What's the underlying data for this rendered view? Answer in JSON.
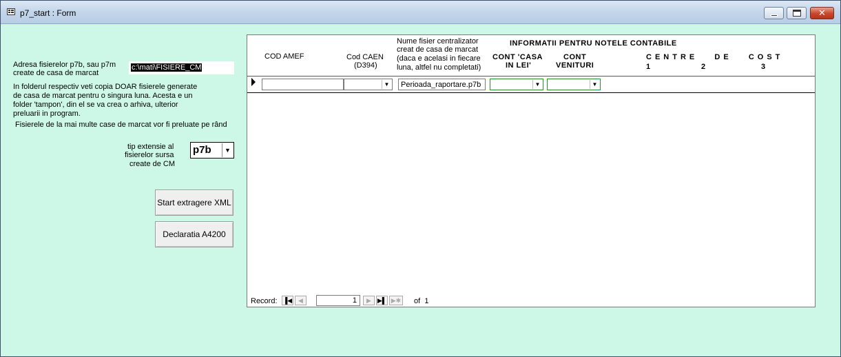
{
  "window": {
    "title": "p7_start : Form"
  },
  "left_panel": {
    "path_label_line1": "Adresa fisierelor p7b, sau p7m",
    "path_label_line2": "create de casa de marcat",
    "path_value": "c:\\mati\\FISIERE_CM",
    "info_lines": [
      "In folderul respectiv veti copia DOAR fisierele generate",
      "de casa de marcat pentru o singura luna. Acesta e un",
      "folder 'tampon', din el se va crea o arhiva, ulterior",
      "preluarii in program.",
      " Fisierele de la mai multe case de marcat vor fi preluate pe rând"
    ],
    "ext_label_lines": [
      "tip extensie al",
      "fisierelor sursa",
      "create de CM"
    ],
    "ext_value": "p7b",
    "start_button": "Start extragere XML",
    "declaration_button": "Declaratia A4200"
  },
  "subform": {
    "headers": {
      "cod_amef": "COD AMEF",
      "cod_caen_1": "Cod CAEN",
      "cod_caen_2": "(D394)",
      "nume_fisier": [
        "Nume fisier centralizator",
        "creat de casa de marcat",
        "(daca e acelasi in fiecare",
        "luna, altfel nu completati)"
      ],
      "informatii": "INFORMATII PENTRU NOTELE CONTABILE",
      "cont_casa_1": "CONT 'CASA",
      "cont_casa_2": "IN LEI'",
      "cont_venituri_1": "CONT",
      "cont_venituri_2": "VENITURI",
      "centre_de_cost": "CENTRE   DE   COST",
      "cc1": "1",
      "cc2": "2",
      "cc3": "3"
    },
    "row": {
      "cod_amef": "",
      "cod_caen": "",
      "nume_fisier": "Perioada_raportare.p7b",
      "cont_casa": "",
      "cont_venituri": ""
    }
  },
  "record_nav": {
    "label": "Record:",
    "current": "1",
    "of_label": "of",
    "total": "1"
  }
}
